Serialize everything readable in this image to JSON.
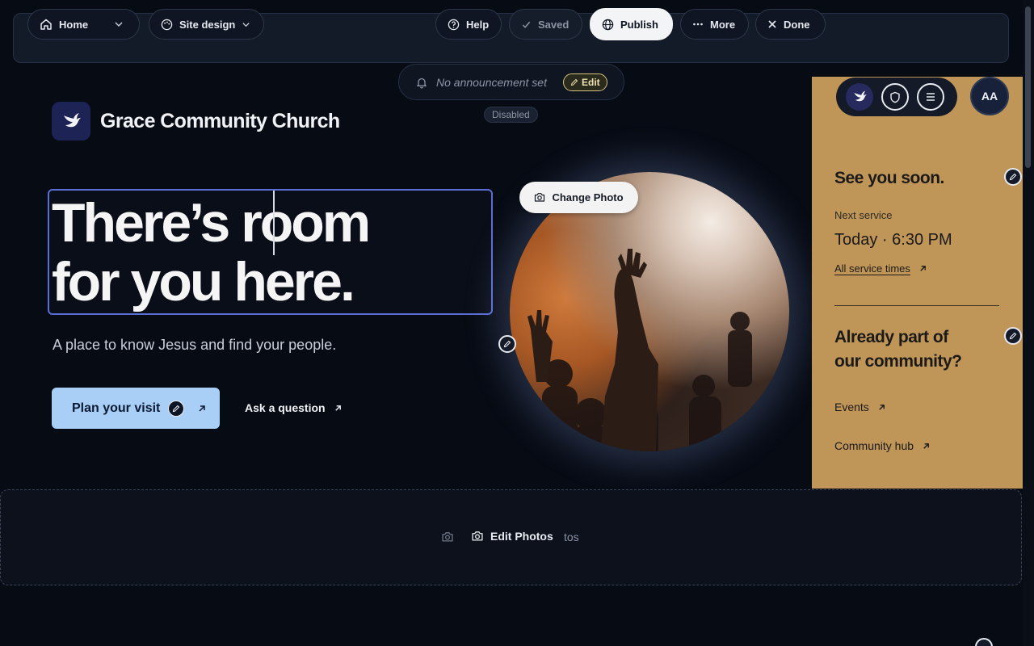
{
  "toolbar": {
    "home_label": "Home",
    "site_design_label": "Site design",
    "help_label": "Help",
    "saved_label": "Saved",
    "publish_label": "Publish",
    "more_label": "More",
    "done_label": "Done"
  },
  "announcement": {
    "text": "No announcement set",
    "edit_label": "Edit",
    "status_badge": "Disabled"
  },
  "site": {
    "name": "Grace Community Church",
    "headline_line1": "There’s room",
    "headline_line2": "for you here.",
    "subtitle": "A place to know Jesus and find your people.",
    "primary_cta": "Plan your visit",
    "secondary_cta": "Ask a question",
    "change_photo_label": "Change Photo"
  },
  "panel": {
    "heading1": "See you soon.",
    "next_service_label": "Next service",
    "next_service_time": "Today · 6:30 PM",
    "all_service_times": "All service times",
    "heading2_line1": "Already part of",
    "heading2_line2": "our community?",
    "link_events": "Events",
    "link_community_hub": "Community hub",
    "avatar_initials": "AA"
  },
  "photos_section": {
    "edit_photos_label": "Edit Photos",
    "ghost_text": "tos"
  },
  "icons": {
    "home": "home-icon",
    "palette": "palette-icon",
    "help": "help-circle-icon",
    "check": "check-icon",
    "globe": "globe-icon",
    "more": "ellipsis-icon",
    "close": "close-icon",
    "bell": "bell-icon",
    "camera": "camera-icon",
    "pencil": "pencil-icon",
    "arrow": "arrow-up-right-icon",
    "dove": "dove-logo-icon",
    "shield": "shield-icon",
    "menu": "menu-icon"
  },
  "colors": {
    "publish_bg": "#f3f4f6",
    "cta_bg": "#a9cff7",
    "panel_bg": "#bf9558",
    "selection_border": "#5a6fd6",
    "logo_bg": "#1e2356"
  }
}
